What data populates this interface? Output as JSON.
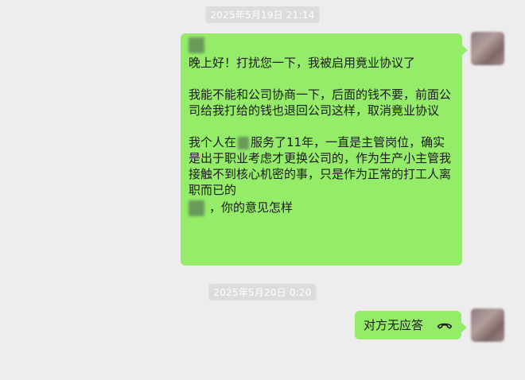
{
  "timestamps": [
    "2025年5月19日 21:14",
    "2025年5月20日 0:20"
  ],
  "message1": {
    "line_greeting": "晚上好！打扰您一下，我被启用竟业协议了",
    "para2": "我能不能和公司协商一下，后面的钱不要，前面公司给我打给的钱也退回公司这样，取消竟业协议",
    "para3_a": "我个人在",
    "para3_b": "服务了11年，一直是主管岗位，确实是出于职业考虑才更换公司的，作为生产小主管我接触不到核心机密的事，只是作为正常的打工人离职而已的",
    "para4": "，你的意见怎样"
  },
  "message2": {
    "text": "对方无应答",
    "icon": "phone-hangup-icon"
  },
  "colors": {
    "bubble": "#95ec69",
    "background": "#ededed",
    "timestamp_bg": "#dcdcdc"
  }
}
